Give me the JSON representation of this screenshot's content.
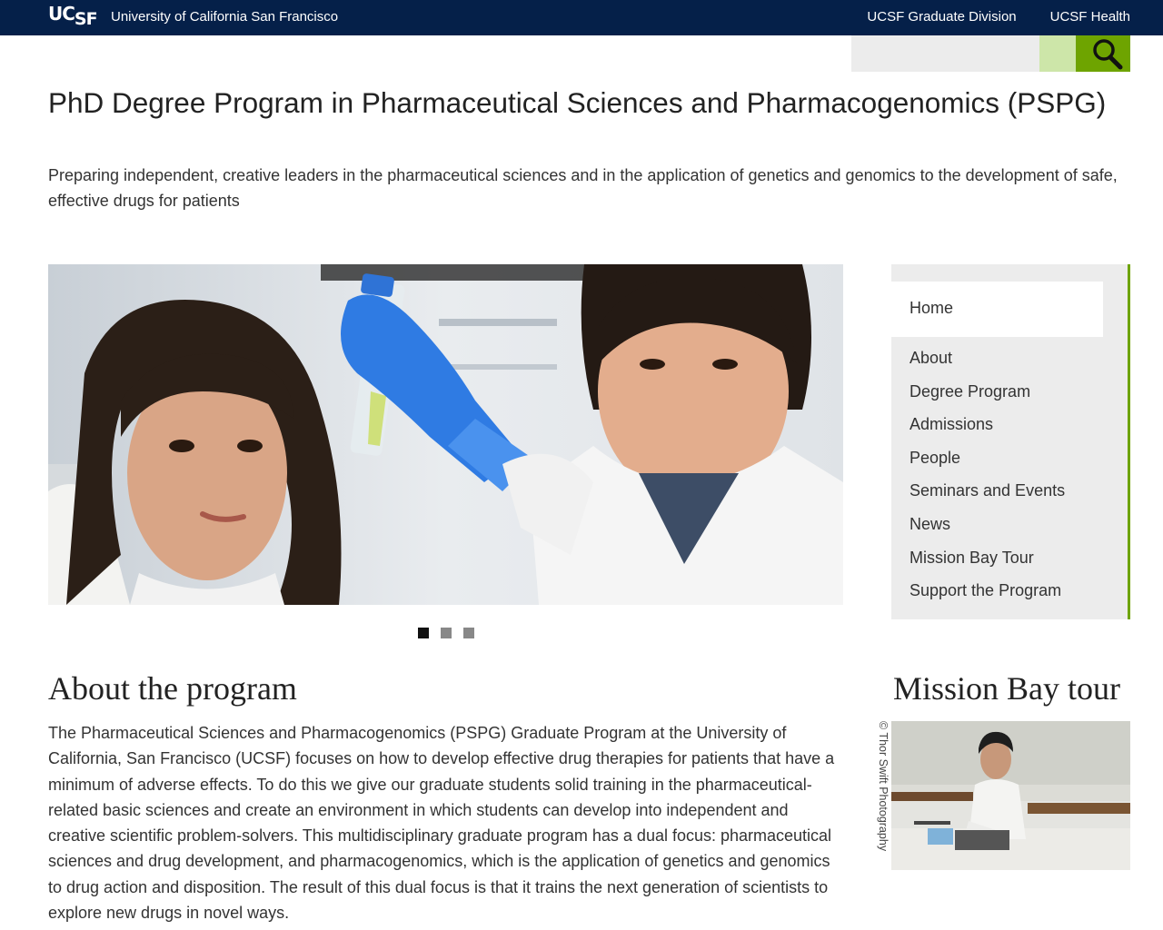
{
  "header": {
    "logo_main": "UC",
    "logo_sub": "SF",
    "university": "University of California San Francisco",
    "links": [
      "UCSF Graduate Division",
      "UCSF Health"
    ]
  },
  "search": {
    "placeholder": "",
    "icon": "search-icon"
  },
  "page": {
    "title": "PhD Degree Program in Pharmaceutical Sciences and Pharmacogenomics (PSPG)",
    "subtitle": "Preparing independent, creative leaders in the pharmaceutical sciences and in the application of genetics and genomics to the development of safe, effective drugs for patients"
  },
  "carousel": {
    "slide_count": 3,
    "active_index": 0
  },
  "sidebar": {
    "home": "Home",
    "items": [
      "About",
      "Degree Program",
      "Admissions",
      "People",
      "Seminars and Events",
      "News",
      "Mission Bay Tour",
      "Support the Program"
    ]
  },
  "about": {
    "heading": "About the program",
    "body": "The Pharmaceutical Sciences and Pharmacogenomics (PSPG) Graduate Program at the University of California, San Francisco (UCSF) focuses on how to develop effective drug therapies for patients that have a minimum of adverse effects. To do this we give our graduate students solid training in the pharmaceutical-related basic sciences and create an environment in which students can develop into independent and creative scientific problem-solvers. This multidisciplinary graduate program has a dual focus: pharmaceutical sciences and drug development, and pharmacogenomics, which is the application of genetics and genomics to drug action and disposition. The result of this dual focus is that it trains the next generation of scientists to explore new drugs in novel ways."
  },
  "tour": {
    "heading": "Mission Bay tour",
    "credit": "© Thor Swift Photography"
  },
  "colors": {
    "navy": "#052049",
    "green": "#6ea400",
    "light_green": "#cde6a9",
    "panel_gray": "#ececec"
  }
}
